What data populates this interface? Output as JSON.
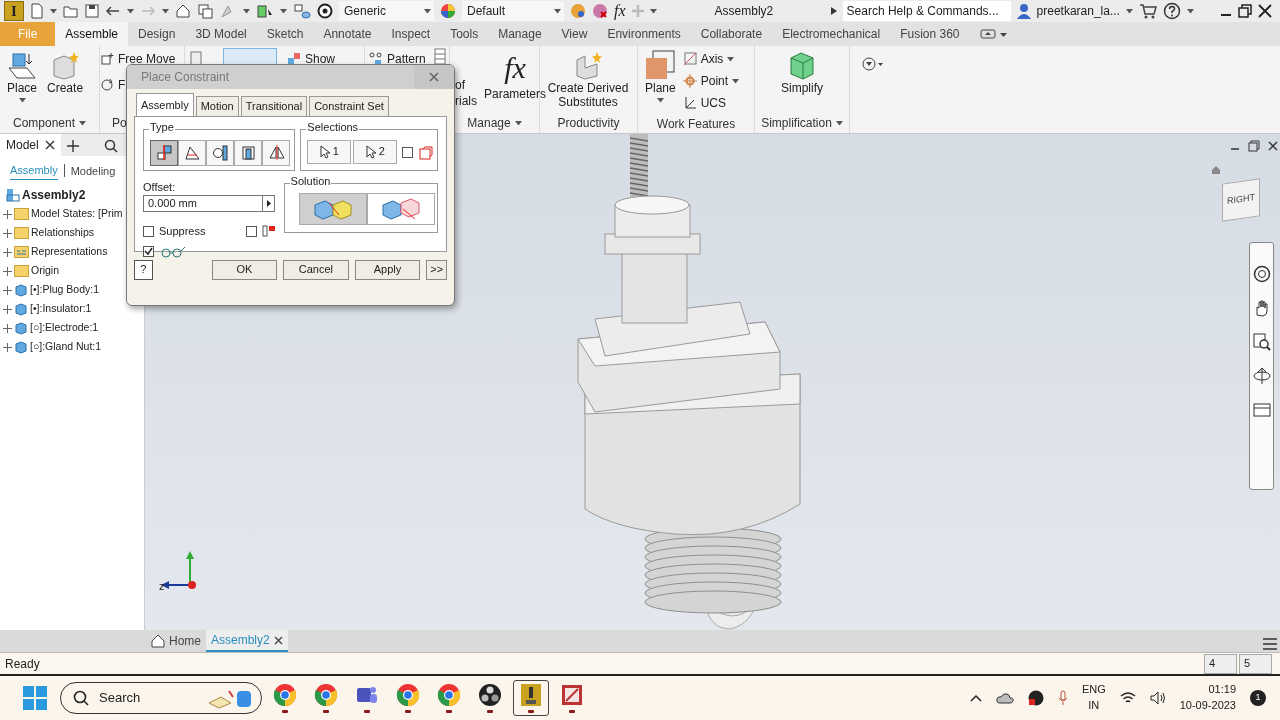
{
  "title_bar": {
    "app_logo": "I",
    "material": "Generic",
    "appearance": "Default",
    "formula_icon": "fx",
    "document_title": "Assembly2",
    "search": {
      "placeholder": "Search Help & Commands..."
    },
    "user": "preetkaran_la..."
  },
  "menu_tabs": [
    {
      "label": "File",
      "kind": "file",
      "selected": false
    },
    {
      "label": "Assemble",
      "kind": "tab",
      "selected": true
    },
    {
      "label": "Design",
      "kind": "tab",
      "selected": false
    },
    {
      "label": "3D Model",
      "kind": "tab",
      "selected": false
    },
    {
      "label": "Sketch",
      "kind": "tab",
      "selected": false
    },
    {
      "label": "Annotate",
      "kind": "tab",
      "selected": false
    },
    {
      "label": "Inspect",
      "kind": "tab",
      "selected": false
    },
    {
      "label": "Tools",
      "kind": "tab",
      "selected": false
    },
    {
      "label": "Manage",
      "kind": "tab",
      "selected": false
    },
    {
      "label": "View",
      "kind": "tab",
      "selected": false
    },
    {
      "label": "Environments",
      "kind": "tab",
      "selected": false
    },
    {
      "label": "Collaborate",
      "kind": "tab",
      "selected": false
    },
    {
      "label": "Electromechanical",
      "kind": "tab",
      "selected": false
    },
    {
      "label": "Fusion 360",
      "kind": "tab",
      "selected": false
    }
  ],
  "ribbon": [
    {
      "title": "Component",
      "kind": "component",
      "items": [
        "Place",
        "Create"
      ]
    },
    {
      "title": "Po",
      "kind": "position",
      "items": [
        "Free Move",
        "F"
      ]
    },
    {
      "kind": "relationships",
      "items": [
        "Show"
      ]
    },
    {
      "kind": "pattern",
      "items": [
        "Pattern"
      ]
    },
    {
      "title": "Manage",
      "kind": "manage",
      "glyph": "fx",
      "items": [
        "of",
        "rials",
        "Parameters"
      ]
    },
    {
      "title": "Productivity",
      "kind": "productivity",
      "items": [
        "Create Derived Substitutes"
      ]
    },
    {
      "title": "Work Features",
      "kind": "work",
      "items": [
        "Plane",
        "Axis",
        "Point",
        "UCS"
      ]
    },
    {
      "title": "Simplification",
      "kind": "simplify",
      "items": [
        "Simplify"
      ]
    }
  ],
  "dialog": {
    "title": "Place Constraint",
    "tabs": [
      {
        "label": "Assembly",
        "selected": true
      },
      {
        "label": "Motion",
        "selected": false
      },
      {
        "label": "Transitional",
        "selected": false
      },
      {
        "label": "Constraint Set",
        "selected": false
      }
    ],
    "type_label": "Type",
    "type_buttons": [
      {
        "kind": "mate",
        "selected": true
      },
      {
        "kind": "angle",
        "selected": false
      },
      {
        "kind": "tangent",
        "selected": false
      },
      {
        "kind": "insert",
        "selected": false
      },
      {
        "kind": "symmetry",
        "selected": false
      }
    ],
    "selections_label": "Selections",
    "selection_buttons": [
      "1",
      "2"
    ],
    "pick_part_first": {
      "checked": false
    },
    "offset": {
      "label": "Offset:",
      "value": "0.000 mm"
    },
    "solution_label": "Solution",
    "solutions": [
      {
        "kind": "mate",
        "selected": true
      },
      {
        "kind": "flush",
        "selected": false
      }
    ],
    "suppress": {
      "label": "Suppress",
      "checked": false
    },
    "show_limits": {
      "checked": false
    },
    "preview": {
      "checked": true
    },
    "help": "?",
    "buttons": [
      "OK",
      "Cancel",
      "Apply",
      ">>"
    ]
  },
  "browser": {
    "title": "Model",
    "view_tabs": [
      {
        "label": "Assembly",
        "selected": true
      },
      {
        "label": "Modeling",
        "selected": false
      }
    ],
    "tree": {
      "label": "Assembly2",
      "children": [
        {
          "label": "Model States: [Prim",
          "kind": "folder"
        },
        {
          "label": "Relationships",
          "kind": "folder"
        },
        {
          "label": "Representations",
          "kind": "representations"
        },
        {
          "label": "Origin",
          "kind": "folder"
        },
        {
          "label": "[•]:Plug Body:1",
          "kind": "part"
        },
        {
          "label": "[•]:Insulator:1",
          "kind": "part"
        },
        {
          "label": "[○]:Electrode:1",
          "kind": "part"
        },
        {
          "label": "[○]:Gland Nut:1",
          "kind": "part"
        }
      ]
    }
  },
  "viewport": {
    "view_cube": "RIGHT",
    "axis_label": "z"
  },
  "doc_tabs": [
    {
      "label": "Home",
      "kind": "home",
      "selected": false
    },
    {
      "label": "Assembly2",
      "kind": "document",
      "selected": true
    }
  ],
  "status_bar": {
    "text": "Ready",
    "cells": [
      "4",
      "5"
    ]
  },
  "taskbar": {
    "search": {
      "placeholder": "Search"
    },
    "apps": [
      {
        "kind": "browser",
        "selected": false
      },
      {
        "kind": "browser",
        "selected": false
      },
      {
        "kind": "chat",
        "selected": false
      },
      {
        "kind": "browser",
        "selected": false
      },
      {
        "kind": "browser",
        "selected": false
      },
      {
        "kind": "recorder",
        "selected": false
      },
      {
        "kind": "cad",
        "selected": true
      },
      {
        "kind": "image",
        "selected": false
      }
    ],
    "tray": {
      "language": "ENG",
      "region": "IN",
      "time": "01:19",
      "date": "10-09-2023",
      "notifications": "1"
    }
  }
}
